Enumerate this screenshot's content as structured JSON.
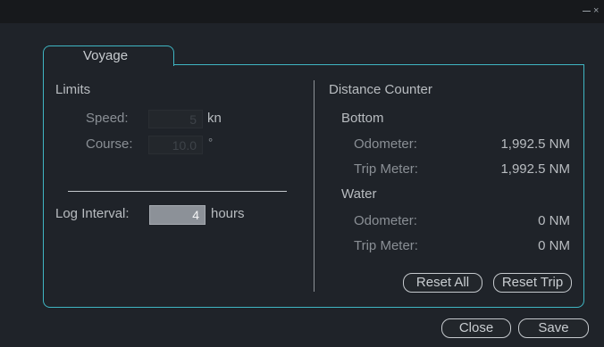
{
  "window": {
    "close_glyph": "×"
  },
  "tab": {
    "label": "Voyage"
  },
  "limits": {
    "heading": "Limits",
    "speed_label": "Speed:",
    "speed_value": "5",
    "speed_unit": "kn",
    "course_label": "Course:",
    "course_value": "10.0",
    "course_unit": "°",
    "log_interval_label": "Log Interval:",
    "log_interval_value": "4",
    "log_interval_unit": "hours"
  },
  "distance_counter": {
    "heading": "Distance Counter",
    "bottom": {
      "heading": "Bottom",
      "odometer_label": "Odometer:",
      "odometer_value": "1,992.5 NM",
      "trip_label": "Trip Meter:",
      "trip_value": "1,992.5 NM"
    },
    "water": {
      "heading": "Water",
      "odometer_label": "Odometer:",
      "odometer_value": "0 NM",
      "trip_label": "Trip Meter:",
      "trip_value": "0 NM"
    },
    "reset_all_label": "Reset All",
    "reset_trip_label": "Reset Trip"
  },
  "footer": {
    "close_label": "Close",
    "save_label": "Save"
  },
  "colors": {
    "background": "#1f2329",
    "titlebar": "#17191c",
    "accent": "#3fb6c3",
    "text": "#b8bcc0",
    "dim_text": "#8a8f95",
    "enabled_field": "#8c9198"
  }
}
